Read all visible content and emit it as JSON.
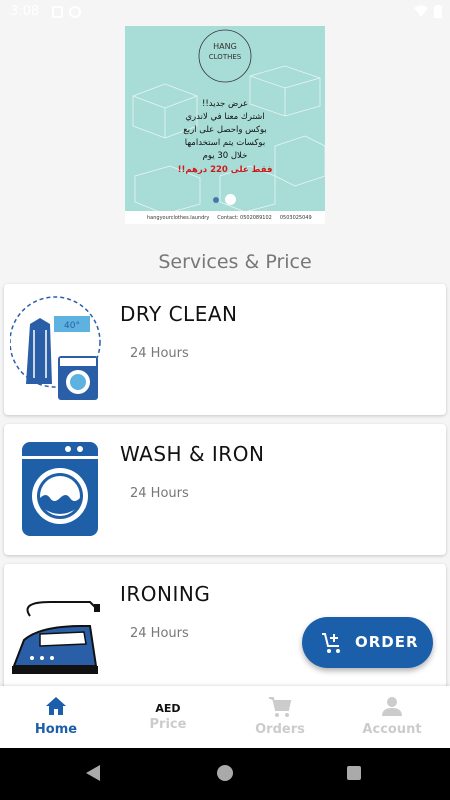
{
  "status_bar": {
    "time": "3:08"
  },
  "banner": {
    "logo_line1": "HANG",
    "logo_line2": "CLOTHES",
    "arabic_lines": [
      "عرض جديد!!",
      "اشترك معنا في لاندري",
      "بوكس واحصل على اربع",
      "بوكسات يتم استخدامها",
      "خلال 30 يوم"
    ],
    "arabic_price": "فقط على 220 درهم!!",
    "footer_handle": "hangyourclothes.laundry",
    "footer_contact": "Contact: 0502089102",
    "footer_phone2": "0503025049"
  },
  "section_title": "Services & Price",
  "services": [
    {
      "name": "DRY CLEAN",
      "duration": "24 Hours",
      "icon": "dry-clean-icon"
    },
    {
      "name": "WASH & IRON",
      "duration": "24 Hours",
      "icon": "washing-machine-icon"
    },
    {
      "name": "IRONING",
      "duration": "24 Hours",
      "icon": "iron-icon"
    }
  ],
  "fab": {
    "label": "ORDER",
    "icon": "add-cart-icon"
  },
  "bottom_nav": [
    {
      "label": "Home",
      "icon": "home-icon",
      "active": true
    },
    {
      "label": "Price",
      "icon_text": "AED",
      "active": false
    },
    {
      "label": "Orders",
      "icon": "cart-icon",
      "active": false
    },
    {
      "label": "Account",
      "icon": "person-icon",
      "active": false
    }
  ],
  "colors": {
    "primary": "#1b5eaa",
    "banner_bg": "#a8dcd6",
    "inactive": "#cccccc"
  }
}
